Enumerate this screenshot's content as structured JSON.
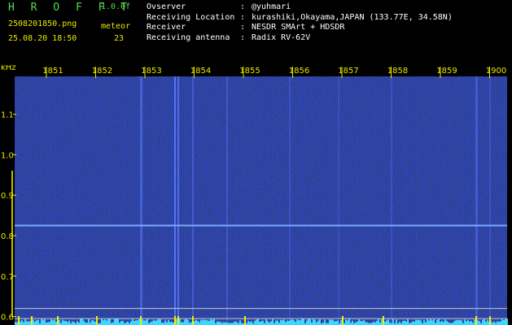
{
  "app": {
    "brand": "H R O F F T",
    "version": "1.0.0f"
  },
  "file": {
    "name": "2508201850.png",
    "datetime": "25.08.20 18:50"
  },
  "meteor": {
    "label": "meteor",
    "count": "23"
  },
  "station": {
    "rows": [
      {
        "label": "Ovserver",
        "value": "@yuhmari"
      },
      {
        "label": "Receiving Location",
        "value": "kurashiki,Okayama,JAPAN (133.77E, 34.58N)"
      },
      {
        "label": "Receiver",
        "value": "NESDR SMArt + HDSDR"
      },
      {
        "label": "Receiving antenna",
        "value": "Radix RV-62V"
      }
    ]
  },
  "colors": {
    "brand": "#55d955",
    "accent": "#e8e800",
    "signal": "#7fa8ff",
    "background": "#000000",
    "noise": "#0b18a8"
  },
  "chart_data": {
    "type": "heatmap",
    "ylabel": "kHz",
    "time_ticks": [
      "1851",
      "1852",
      "1853",
      "1854",
      "1855",
      "1856",
      "1857",
      "1858",
      "1859",
      "1900"
    ],
    "freq_ticks": [
      "1.1",
      "1.0",
      "0.9",
      "0.8",
      "0.7",
      "0.6"
    ],
    "ylim": [
      0.575,
      1.19
    ],
    "carrier_khz": 0.825,
    "reference_lines_khz": [
      0.62,
      0.595
    ],
    "grid": false
  }
}
